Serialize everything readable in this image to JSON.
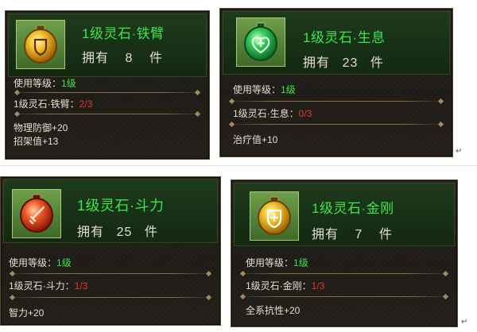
{
  "cards": [
    {
      "title": "1级灵石·铁臂",
      "own_label": "拥有",
      "count": "8",
      "unit": "件",
      "level_label": "使用等级：",
      "level_value": "1级",
      "req_name": "1级灵石·铁臂：",
      "req_progress": "2/3",
      "stats": [
        "物理防御+20",
        "招架值+13"
      ],
      "gem_icon": "shield-icon",
      "gem_color": "#e0a51c"
    },
    {
      "title": "1级灵石·生息",
      "own_label": "拥有",
      "count": "23",
      "unit": "件",
      "level_label": "使用等级：",
      "level_value": "1级",
      "req_name": "1级灵石·生息：",
      "req_progress": "0/3",
      "stats": [
        "治疗值+10"
      ],
      "gem_icon": "heart-plus-icon",
      "gem_color": "#2fbf52"
    },
    {
      "title": "1级灵石·斗力",
      "own_label": "拥有",
      "count": "25",
      "unit": "件",
      "level_label": "使用等级：",
      "level_value": "1级",
      "req_name": "1级灵石·斗力：",
      "req_progress": "1/3",
      "stats": [
        "智力+20"
      ],
      "gem_icon": "sword-icon",
      "gem_color": "#e0452a"
    },
    {
      "title": "1级灵石·金刚",
      "own_label": "拥有",
      "count": "7",
      "unit": "件",
      "level_label": "使用等级：",
      "level_value": "1级",
      "req_name": "1级灵石·金刚：",
      "req_progress": "1/3",
      "stats": [
        "全系抗性+20"
      ],
      "gem_icon": "shield-plus-icon",
      "gem_color": "#e8b41e"
    }
  ],
  "paragraph_mark": "↵"
}
